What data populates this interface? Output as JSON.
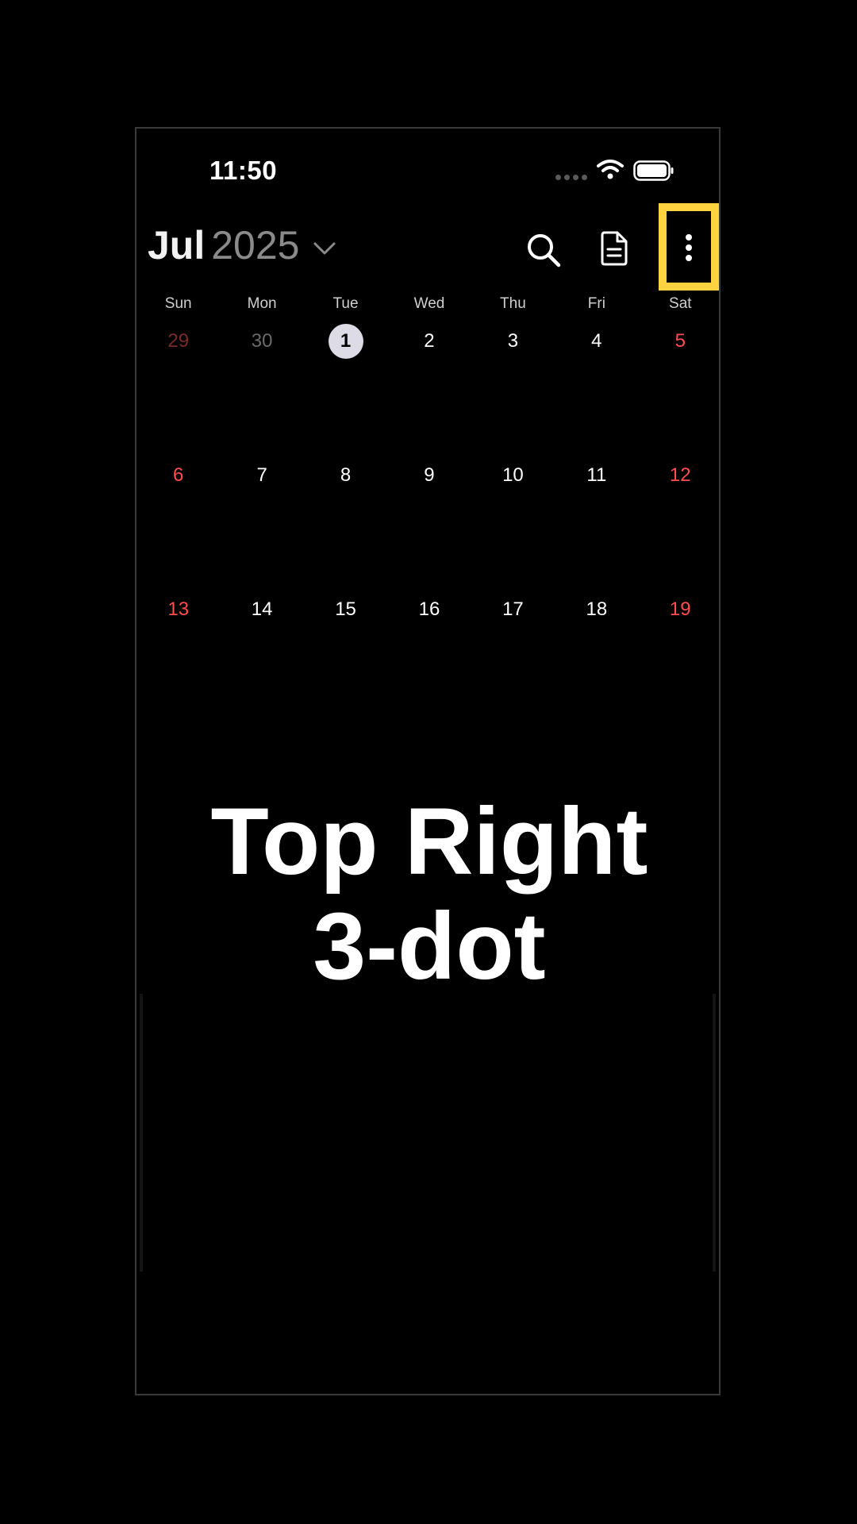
{
  "status": {
    "time": "11:50"
  },
  "header": {
    "month": "Jul",
    "year": "2025"
  },
  "weekdays": [
    "Sun",
    "Mon",
    "Tue",
    "Wed",
    "Thu",
    "Fri",
    "Sat"
  ],
  "weeks": [
    [
      "29",
      "30",
      "1",
      "2",
      "3",
      "4",
      "5"
    ],
    [
      "6",
      "7",
      "8",
      "9",
      "10",
      "11",
      "12"
    ],
    [
      "13",
      "14",
      "15",
      "16",
      "17",
      "18",
      "19"
    ]
  ],
  "today": "1",
  "overlay": {
    "line1": "Top Right",
    "line2": "3-dot"
  },
  "colors": {
    "highlight": "#ffd23f",
    "weekend": "#ff4d4d",
    "today_bg": "#dcdbe6"
  },
  "icons": {
    "search": "search-icon",
    "notes": "document-icon",
    "more": "more-vertical-icon"
  }
}
